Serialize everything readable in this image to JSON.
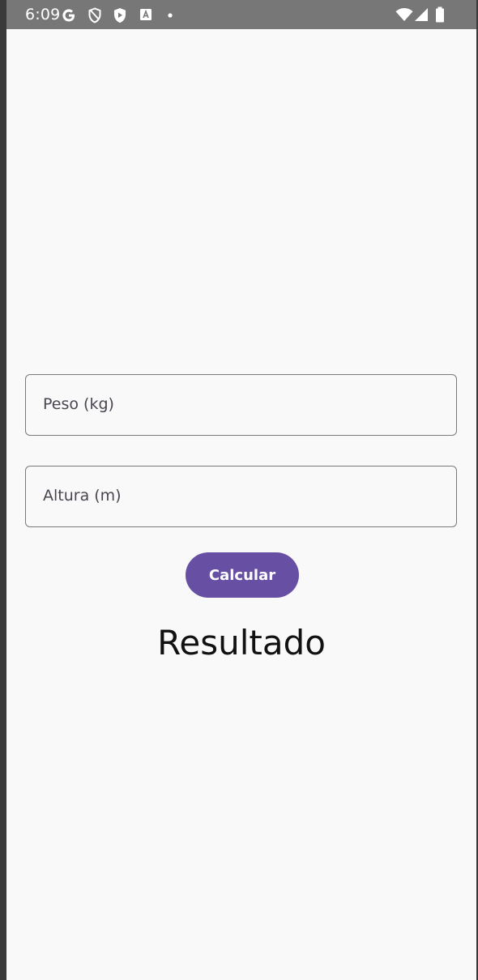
{
  "status_bar": {
    "time": "6:09",
    "left_icons": [
      "google-icon",
      "vpn-shield-icon",
      "play-protect-icon",
      "app-notification-icon",
      "dot-icon"
    ],
    "right_icons": [
      "wifi-icon",
      "cell-signal-icon",
      "battery-icon"
    ]
  },
  "form": {
    "weight_label": "Peso (kg)",
    "height_label": "Altura (m)",
    "calculate_label": "Calcular",
    "result_text": "Resultado"
  },
  "colors": {
    "primary": "#6750a4",
    "status_bar": "#777777",
    "background": "#f9f9f9"
  }
}
